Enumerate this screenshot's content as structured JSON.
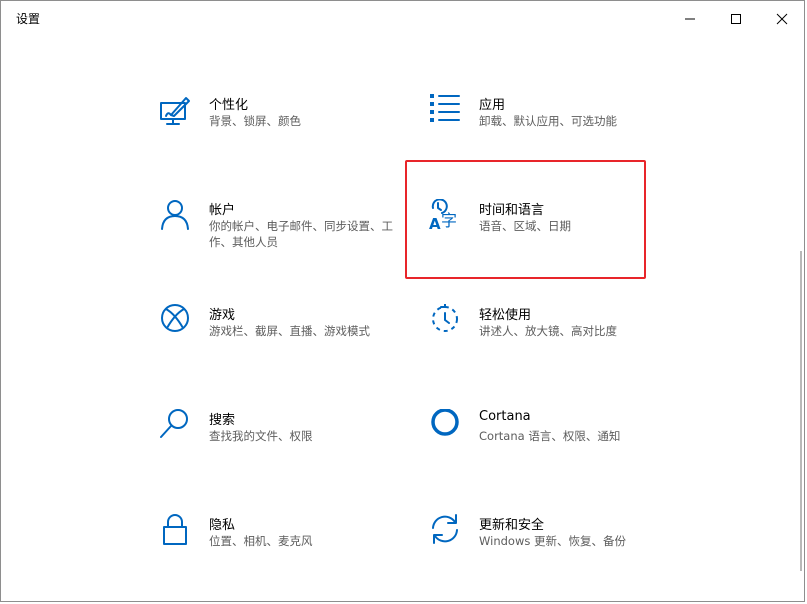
{
  "window": {
    "title": "设置"
  },
  "controls": {
    "minimize": "minimize-icon",
    "maximize": "maximize-icon",
    "close": "close-icon"
  },
  "accent": "#0067c0",
  "highlight_color": "#e8252a",
  "tiles": [
    {
      "title": "个性化",
      "desc": "背景、锁屏、颜色",
      "icon": "personalization-icon"
    },
    {
      "title": "应用",
      "desc": "卸载、默认应用、可选功能",
      "icon": "apps-icon"
    },
    {
      "title": "帐户",
      "desc": "你的帐户、电子邮件、同步设置、工作、其他人员",
      "icon": "account-icon"
    },
    {
      "title": "时间和语言",
      "desc": "语音、区域、日期",
      "icon": "time-language-icon"
    },
    {
      "title": "游戏",
      "desc": "游戏栏、截屏、直播、游戏模式",
      "icon": "xbox-icon"
    },
    {
      "title": "轻松使用",
      "desc": "讲述人、放大镜、高对比度",
      "icon": "ease-of-access-icon"
    },
    {
      "title": "搜索",
      "desc": "查找我的文件、权限",
      "icon": "search-icon"
    },
    {
      "title": "Cortana",
      "desc": "Cortana 语言、权限、通知",
      "icon": "cortana-icon"
    },
    {
      "title": "隐私",
      "desc": "位置、相机、麦克风",
      "icon": "lock-icon"
    },
    {
      "title": "更新和安全",
      "desc": "Windows 更新、恢复、备份",
      "icon": "update-icon"
    }
  ]
}
